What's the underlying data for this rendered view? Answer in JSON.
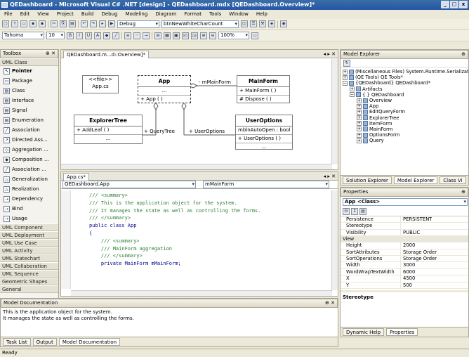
{
  "window": {
    "title": "QEDashboard - Microsoft Visual C# .NET [design] - QEDashboard.mdx [QEDashboard.Overview]*",
    "controls": [
      "_",
      "□",
      "x"
    ]
  },
  "menu": [
    "File",
    "Edit",
    "View",
    "Project",
    "Build",
    "Debug",
    "Modeling",
    "Diagram",
    "Format",
    "Tools",
    "Window",
    "Help"
  ],
  "toolbar1": {
    "config": "Debug",
    "target": "btnNewWhiteCharCount"
  },
  "toolbar2": {
    "font": "Tahoma",
    "size": "10",
    "zoom": "100%"
  },
  "toolbox": {
    "title": "Toolbox",
    "category": "UML Class",
    "items": [
      "Pointer",
      "Package",
      "Class",
      "Interface",
      "Signal",
      "Enumeration",
      "Association",
      "Directed Ass...",
      "Aggregation ...",
      "Composition ...",
      "Association ...",
      "Generalization",
      "Realization",
      "Dependency",
      "Bind",
      "Usage"
    ],
    "categories": [
      "UML Component",
      "UML Deployment",
      "UML Use Case",
      "UML Activity",
      "UML Statechart",
      "UML Collaboration",
      "UML Sequence",
      "Geometric Shapes",
      "General"
    ]
  },
  "diagram": {
    "tab": "QEDashboard.m...d::Overview]*",
    "package": {
      "stereo": "<<file>>",
      "name": "App.cs"
    },
    "app": {
      "name": "App",
      "dots": "...",
      "op": "+ App ( )"
    },
    "mainform": {
      "name": "MainForm",
      "ops": [
        "+ MainForm ( )",
        "# Dispose ( )"
      ]
    },
    "explorertree": {
      "name": "ExplorerTree",
      "op": "+ AddLeaf ( )"
    },
    "useroptions": {
      "name": "UserOptions",
      "attr": "mblnAutoOpen : bool",
      "op": "+ UserOptions ( )"
    },
    "labels": {
      "mainform_role": "- mMainForm",
      "querytree_role": "+ QueryTree",
      "useroptions_role": "+ UserOptions"
    }
  },
  "code": {
    "tab": "App.cs*",
    "class_combo": "QEDashboard.App",
    "member_combo": "mMainForm",
    "lines": [
      {
        "t": "/// <summary>",
        "k": "cm"
      },
      {
        "t": "/// This is the application object for the system.",
        "k": "cm"
      },
      {
        "t": "/// It manages the state as well as controlling the forms.",
        "k": "cm"
      },
      {
        "t": "/// </summary>",
        "k": "cm"
      },
      {
        "t": "public class App",
        "k": "kw"
      },
      {
        "t": "{",
        "k": "kw"
      },
      {
        "t": "    /// <summary>",
        "k": "cm"
      },
      {
        "t": "    /// MainForm aggregation",
        "k": "cm"
      },
      {
        "t": "    /// </summary>",
        "k": "cm"
      },
      {
        "t": "    private MainForm mMainForm;",
        "k": "kw"
      }
    ]
  },
  "model_explorer": {
    "title": "Model Explorer",
    "items": [
      {
        "text": "(Miscellaneous Files) System.Runtime.Serializatio",
        "indent": 0
      },
      {
        "text": "(QE Tools) QE Tools*",
        "indent": 0
      },
      {
        "text": "{QEDashboard} QEDashboard*",
        "indent": 0
      },
      {
        "text": "Artifacts",
        "indent": 1
      },
      {
        "text": "{ } QEDashboard",
        "indent": 1
      },
      {
        "text": "Overview",
        "indent": 2
      },
      {
        "text": "App",
        "indent": 2
      },
      {
        "text": "EditQueryForm",
        "indent": 2
      },
      {
        "text": "ExplorerTree",
        "indent": 2
      },
      {
        "text": "ItemForm",
        "indent": 2
      },
      {
        "text": "MainForm",
        "indent": 2
      },
      {
        "text": "OptionsForm",
        "indent": 2
      },
      {
        "text": "Query",
        "indent": 2
      }
    ],
    "tabs": [
      "Solution Explorer",
      "Model Explorer",
      "Class Vi"
    ]
  },
  "properties": {
    "title": "Properties",
    "object": "App <Class>",
    "rows": [
      {
        "k": "Persistence",
        "v": "PERSISTENT"
      },
      {
        "k": "Stereotype",
        "v": ""
      },
      {
        "k": "Visibility",
        "v": "PUBLIC"
      }
    ],
    "category": "View",
    "view_rows": [
      {
        "k": "Height",
        "v": "2000"
      },
      {
        "k": "SortAttributes",
        "v": "Storage Order"
      },
      {
        "k": "SortOperations",
        "v": "Storage Order"
      },
      {
        "k": "Width",
        "v": "3000"
      },
      {
        "k": "WordWrapTextWidth",
        "v": "6000"
      },
      {
        "k": "X",
        "v": "4500"
      },
      {
        "k": "Y",
        "v": "500"
      }
    ],
    "desc": "Stereotype",
    "tabs": [
      "Dynamic Help",
      "Properties"
    ]
  },
  "doc": {
    "title": "Model Documentation",
    "lines": [
      "This is the application object for the system.",
      "It manages the state as well as controlling the forms."
    ],
    "tabs": [
      "Task List",
      "Output",
      "Model Documentation"
    ]
  },
  "status": "Ready"
}
